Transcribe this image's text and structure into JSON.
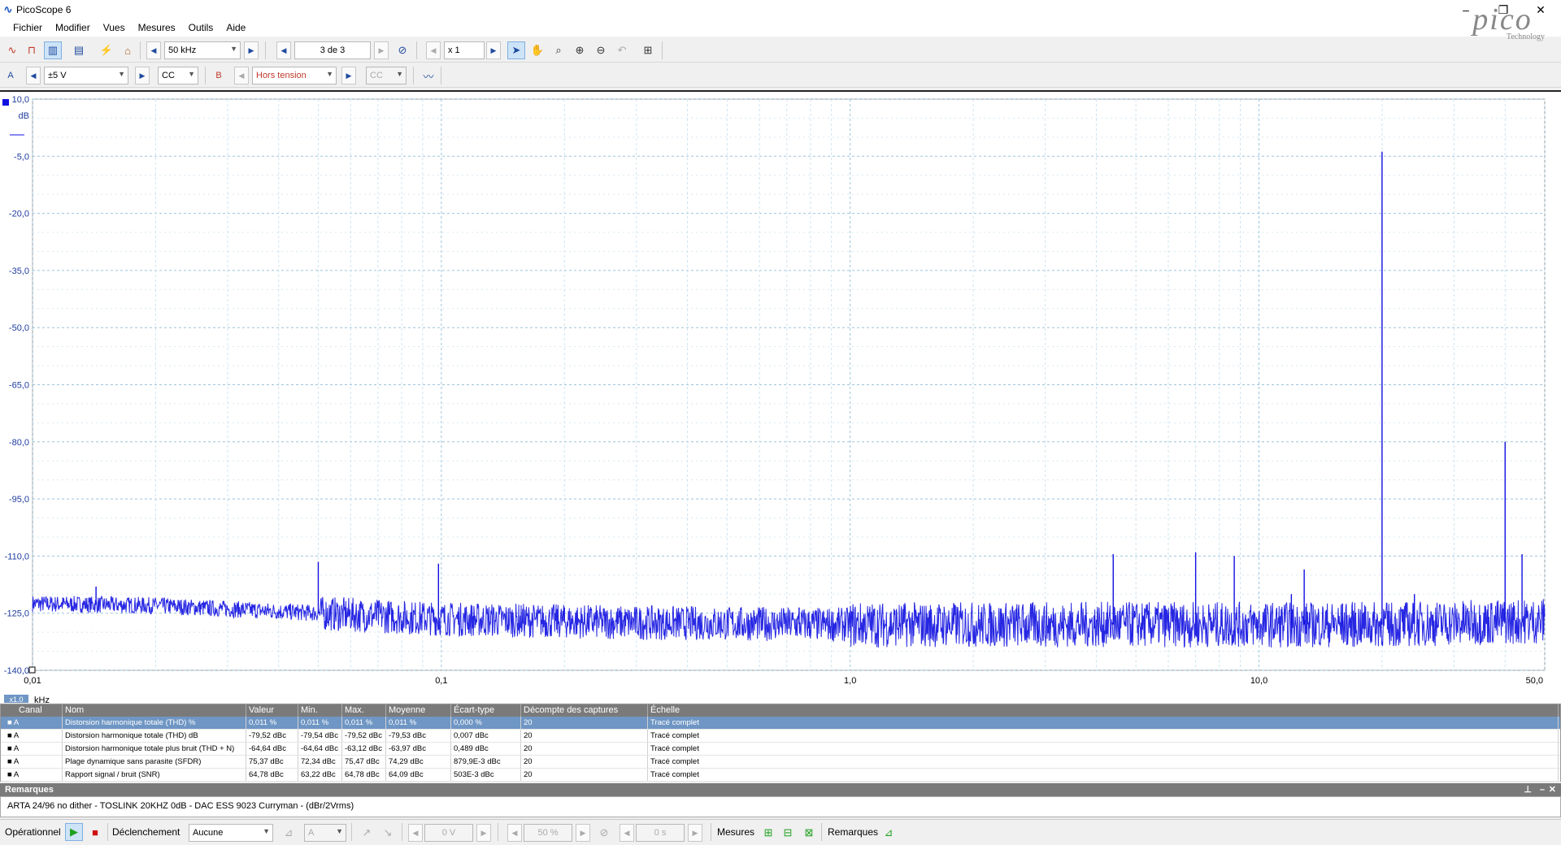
{
  "window": {
    "title": "PicoScope 6",
    "minimize": "–",
    "restore": "❐",
    "close": "✕"
  },
  "menu": [
    "Fichier",
    "Modifier",
    "Vues",
    "Mesures",
    "Outils",
    "Aide"
  ],
  "toolbar1": {
    "timebase": "50 kHz",
    "capture": "3 de 3",
    "zoom": "x 1"
  },
  "toolbar2": {
    "channel_a_label": "A",
    "channel_a_range": "±5 V",
    "channel_a_coupling": "CC",
    "channel_b_label": "B",
    "channel_b_range": "Hors tension",
    "channel_b_coupling": "CC"
  },
  "logo": {
    "text": "pico",
    "subtitle": "Technology"
  },
  "chart_data": {
    "type": "line",
    "y_unit": "dB",
    "x_unit": "kHz",
    "x_scale": "log",
    "xlim": [
      0.01,
      50.0
    ],
    "ylim": [
      -140.0,
      10.0
    ],
    "y_ticks": [
      "10,0",
      "-5,0",
      "-20,0",
      "-35,0",
      "-50,0",
      "-65,0",
      "-80,0",
      "-95,0",
      "-110,0",
      "-125,0",
      "-140,0"
    ],
    "y_tick_values": [
      10,
      -5,
      -20,
      -35,
      -50,
      -65,
      -80,
      -95,
      -110,
      -125,
      -140
    ],
    "x_ticks": [
      "0,01",
      "0,1",
      "1,0",
      "10,0",
      "50,0"
    ],
    "x_tick_values": [
      0.01,
      0.1,
      1.0,
      10.0,
      50.0
    ],
    "x_zoom_badge": "x1.0",
    "grid": true,
    "series_color": "#1010e0",
    "noise_floor": [
      {
        "x": 0.01,
        "y": -122.5
      },
      {
        "x": 0.02,
        "y": -123.0
      },
      {
        "x": 0.05,
        "y": -125.0
      },
      {
        "x": 0.1,
        "y": -126.5
      },
      {
        "x": 0.3,
        "y": -127.5
      },
      {
        "x": 1.0,
        "y": -128.0
      },
      {
        "x": 5.0,
        "y": -128.0
      },
      {
        "x": 20.0,
        "y": -128.0
      },
      {
        "x": 50.0,
        "y": -127.0
      }
    ],
    "peaks": [
      {
        "x": 0.0143,
        "y": -118.0
      },
      {
        "x": 0.05,
        "y": -111.5
      },
      {
        "x": 0.0984,
        "y": -112.0
      },
      {
        "x": 0.2,
        "y": -123.5
      },
      {
        "x": 0.75,
        "y": -123.5
      },
      {
        "x": 4.4,
        "y": -109.5
      },
      {
        "x": 7.0,
        "y": -109.0
      },
      {
        "x": 8.7,
        "y": -110.0
      },
      {
        "x": 12.0,
        "y": -120.0
      },
      {
        "x": 12.9,
        "y": -113.5
      },
      {
        "x": 16.0,
        "y": -122.5
      },
      {
        "x": 20.0,
        "y": -3.8
      },
      {
        "x": 24.0,
        "y": -120.0
      },
      {
        "x": 40.0,
        "y": -80.0
      },
      {
        "x": 44.0,
        "y": -109.5
      }
    ]
  },
  "measurements": {
    "headers": [
      "Canal",
      "Nom",
      "Valeur",
      "Min.",
      "Max.",
      "Moyenne",
      "Écart-type",
      "Décompte des captures",
      "Échelle"
    ],
    "rows": [
      [
        "A",
        "Distorsion harmonique totale (THD) %",
        "0,011 %",
        "0,011 %",
        "0,011 %",
        "0,011 %",
        "0,000 %",
        "20",
        "Tracé complet"
      ],
      [
        "A",
        "Distorsion harmonique totale (THD) dB",
        "-79,52 dBc",
        "-79,54 dBc",
        "-79,52 dBc",
        "-79,53 dBc",
        "0,007 dBc",
        "20",
        "Tracé complet"
      ],
      [
        "A",
        "Distorsion harmonique totale plus bruit (THD + N)",
        "-64,64 dBc",
        "-64,64 dBc",
        "-63,12 dBc",
        "-63,97 dBc",
        "0,489 dBc",
        "20",
        "Tracé complet"
      ],
      [
        "A",
        "Plage dynamique sans parasite (SFDR)",
        "75,37 dBc",
        "72,34 dBc",
        "75,47 dBc",
        "74,29 dBc",
        "879,9E-3 dBc",
        "20",
        "Tracé complet"
      ],
      [
        "A",
        "Rapport signal / bruit (SNR)",
        "64,78 dBc",
        "63,22 dBc",
        "64,78 dBc",
        "64,09 dBc",
        "503E-3 dBc",
        "20",
        "Tracé complet"
      ]
    ]
  },
  "remarks": {
    "title": "Remarques",
    "text": "ARTA 24/96 no dither - TOSLINK 20KHZ 0dB - DAC ESS 9023 Curryman - (dBr/2Vrms)"
  },
  "statusbar": {
    "mode": "Opérationnel",
    "trigger_label": "Déclenchement",
    "trigger_value": "Aucune",
    "trigger_channel": "A",
    "trigger_level": "0 V",
    "pretrigger": "50 %",
    "delay": "0 s",
    "measures_label": "Mesures",
    "remarks_label": "Remarques"
  }
}
